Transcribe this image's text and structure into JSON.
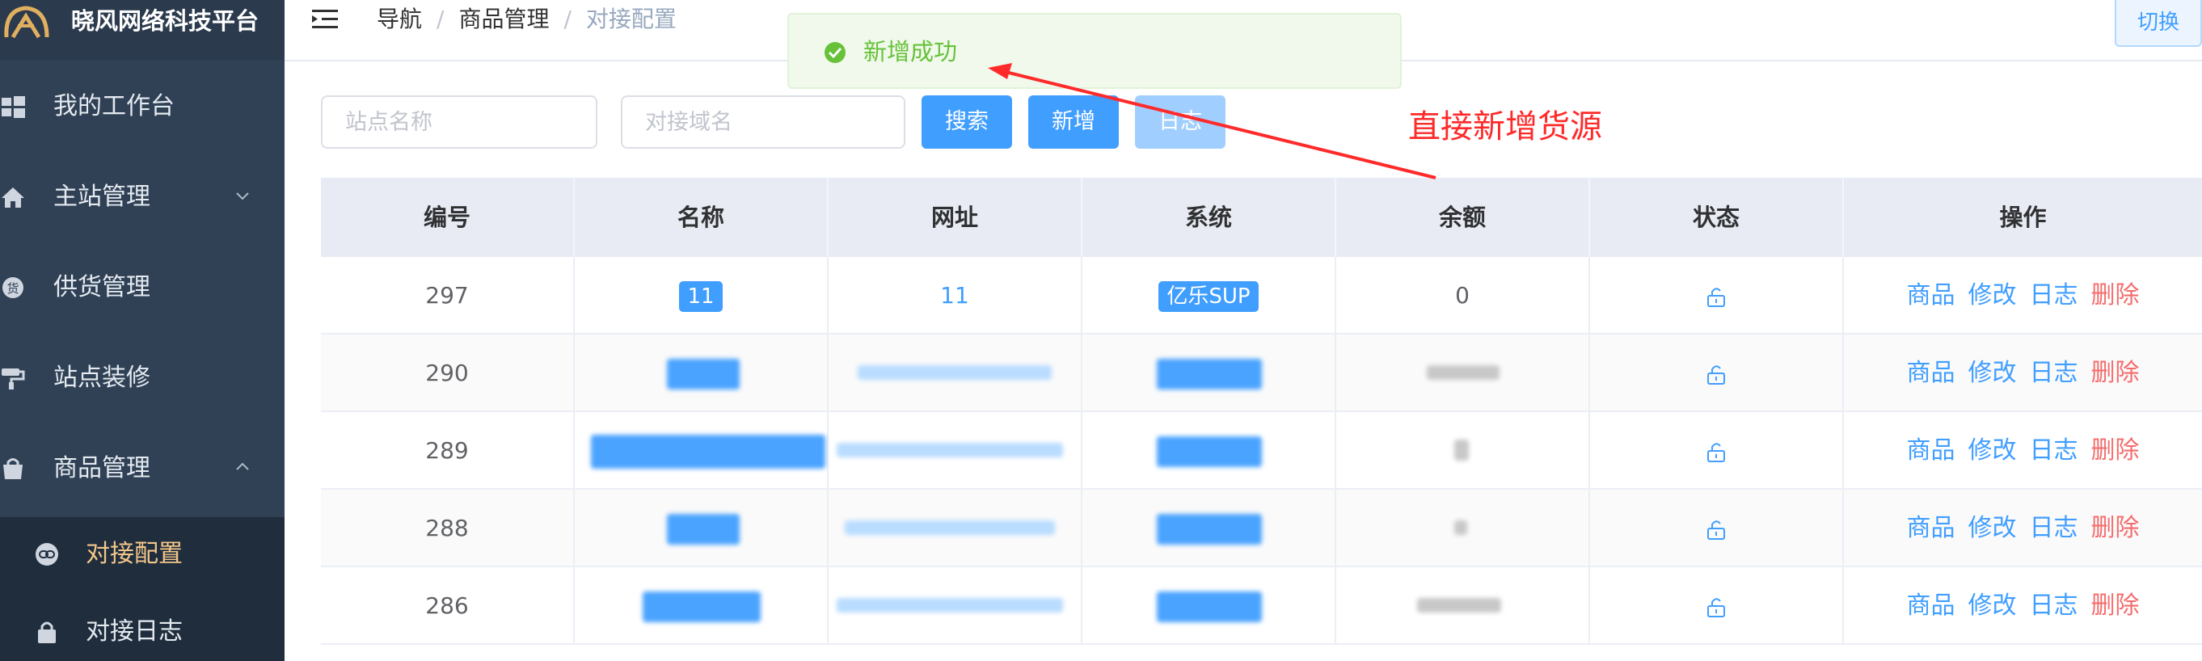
{
  "app": {
    "title": "晓风网络科技平台"
  },
  "sidebar": {
    "items": [
      {
        "label": "我的工作台",
        "icon": "windows-icon"
      },
      {
        "label": "主站管理",
        "icon": "home-icon",
        "expandable": true
      },
      {
        "label": "供货管理",
        "icon": "badge-icon"
      },
      {
        "label": "站点装修",
        "icon": "paint-roller-icon"
      },
      {
        "label": "商品管理",
        "icon": "shopping-bag-icon",
        "expanded": true
      }
    ],
    "subitems": [
      {
        "label": "对接配置",
        "icon": "link-icon",
        "active": true
      },
      {
        "label": "对接日志",
        "icon": "lock-icon"
      }
    ]
  },
  "topbar": {
    "breadcrumb": [
      "导航",
      "商品管理",
      "对接配置"
    ],
    "switch_label": "切换"
  },
  "toast": {
    "message": "新增成功",
    "type": "success"
  },
  "filters": {
    "site_name_placeholder": "站点名称",
    "domain_placeholder": "对接域名",
    "search_label": "搜索",
    "add_label": "新增",
    "log_label": "日志"
  },
  "annotation": {
    "text": "直接新增货源",
    "color": "#ff2a2a"
  },
  "table": {
    "headers": [
      "编号",
      "名称",
      "网址",
      "系统",
      "余额",
      "状态",
      "操作"
    ],
    "rows": [
      {
        "id": "297",
        "name": "11",
        "url": "11",
        "system": "亿乐SUP",
        "balance": "0"
      },
      {
        "id": "290"
      },
      {
        "id": "289"
      },
      {
        "id": "288"
      },
      {
        "id": "286"
      }
    ],
    "actions": [
      "商品",
      "修改",
      "日志",
      "删除"
    ]
  },
  "colors": {
    "sidebar": "#304156",
    "primary": "#409eff",
    "danger": "#f56c6c",
    "success": "#67c23a",
    "active_menu": "#f4c78a"
  }
}
